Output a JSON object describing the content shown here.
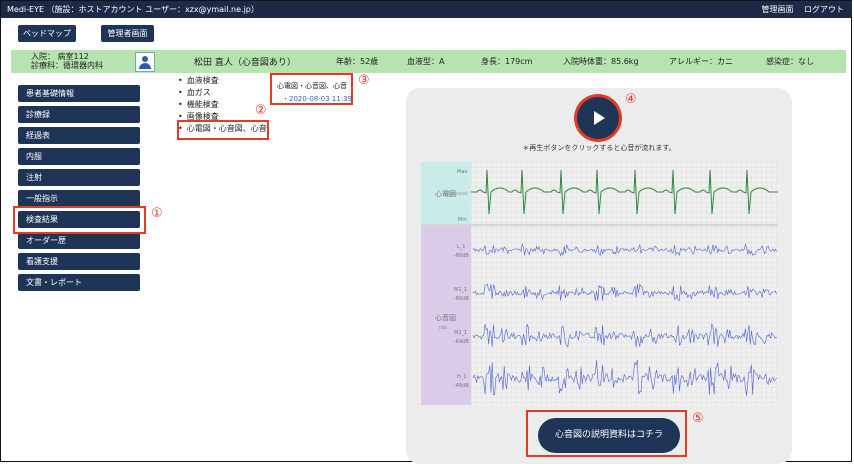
{
  "header": {
    "app_name": "Medi-EYE",
    "account_info": "（施設：ホストアカウント ユーザー：xzx@ymail.ne.jp）",
    "admin_link": "管理画面",
    "logout_link": "ログアウト"
  },
  "toolbar": {
    "bedmap_button": "ベッドマップ",
    "admin_button": "管理者画面"
  },
  "patient": {
    "admission": "入院： 病室112",
    "department": "診療科：循環器内科",
    "name": "松田 直人（心音図あり）",
    "age": "年齢：52歳",
    "blood_type": "血液型：A",
    "height": "身長：179cm",
    "weight": "入院時体重：85.6kg",
    "allergy": "アレルギー：カニ",
    "infection": "感染症：なし"
  },
  "sidebar": {
    "items": [
      {
        "label": "患者基礎情報"
      },
      {
        "label": "診療録"
      },
      {
        "label": "経過表"
      },
      {
        "label": "内服"
      },
      {
        "label": "注射"
      },
      {
        "label": "一般指示"
      },
      {
        "label": "検査結果"
      },
      {
        "label": "オーダー歴"
      },
      {
        "label": "看護支援"
      },
      {
        "label": "文書・レポート"
      }
    ]
  },
  "tests": {
    "items": [
      {
        "label": "血液検査"
      },
      {
        "label": "血ガス"
      },
      {
        "label": "機能検査"
      },
      {
        "label": "画像検査"
      },
      {
        "label": "心電図・心音図、心音"
      }
    ]
  },
  "popup": {
    "title": "心電図・心音図、心音",
    "date": "・2020-08-03 11:39"
  },
  "player": {
    "hint": "＊再生ボタンをクリックすると心音が流れます。",
    "explain_button": "心音図の説明資料はコチラ"
  },
  "charts": {
    "ecg_label": "心電図",
    "ecg_max": "Max",
    "ecg_scale": "50mm/mV",
    "ecg_min": "Min",
    "pcg_label": "心音図",
    "pcg_unit": "(dB)",
    "channels": [
      {
        "name": "L_1",
        "db": "-80dB"
      },
      {
        "name": "M1_1",
        "db": "-80dB"
      },
      {
        "name": "M2_1",
        "db": "-64dB"
      },
      {
        "name": "H_1",
        "db": "-48dB"
      }
    ]
  },
  "annotations": {
    "n1": "①",
    "n2": "②",
    "n3": "③",
    "n4": "④",
    "n5": "⑤"
  },
  "colors": {
    "navy": "#1f3557",
    "header": "#1c2a48",
    "highlight_red": "#e53a26",
    "patient_bar": "#b6e3b0",
    "ecg_bg": "#c9ece8",
    "pcg_bg": "#dccbe8",
    "ecg_trace": "#2e8b3a",
    "pcg_trace": "#4d63d8"
  }
}
